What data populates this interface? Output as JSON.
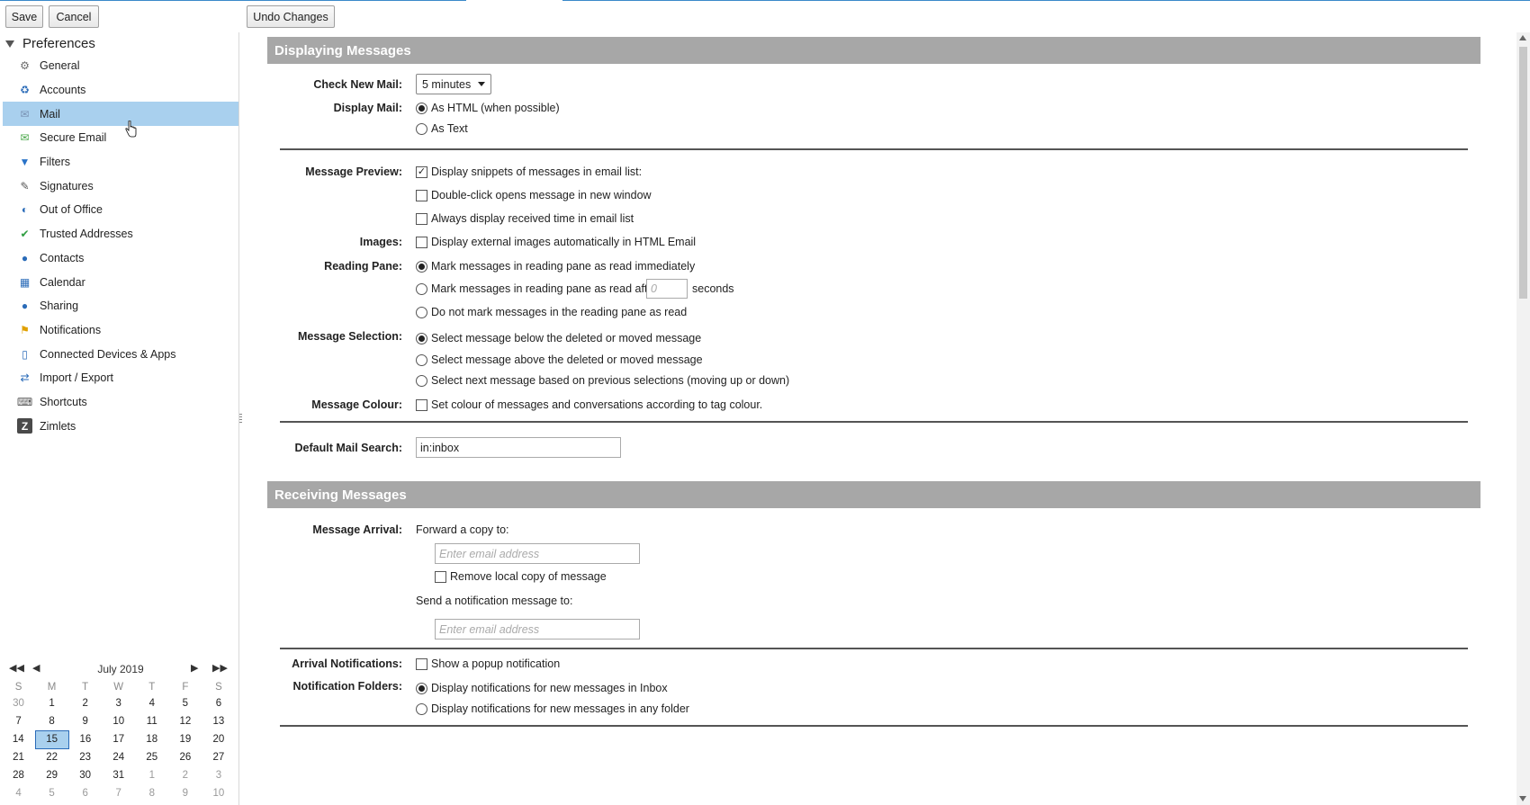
{
  "toolbar": {
    "save": "Save",
    "cancel": "Cancel",
    "undo": "Undo Changes"
  },
  "sidebar": {
    "title": "Preferences",
    "items": [
      {
        "label": "General",
        "icon": "gear-icon"
      },
      {
        "label": "Accounts",
        "icon": "accounts-icon"
      },
      {
        "label": "Mail",
        "icon": "mail-icon",
        "selected": true
      },
      {
        "label": "Secure Email",
        "icon": "secure-email-icon"
      },
      {
        "label": "Filters",
        "icon": "filter-icon"
      },
      {
        "label": "Signatures",
        "icon": "signature-icon"
      },
      {
        "label": "Out of Office",
        "icon": "out-of-office-icon"
      },
      {
        "label": "Trusted Addresses",
        "icon": "shield-icon"
      },
      {
        "label": "Contacts",
        "icon": "contacts-icon"
      },
      {
        "label": "Calendar",
        "icon": "calendar-icon"
      },
      {
        "label": "Sharing",
        "icon": "sharing-icon"
      },
      {
        "label": "Notifications",
        "icon": "bell-icon"
      },
      {
        "label": "Connected Devices & Apps",
        "icon": "device-icon"
      },
      {
        "label": "Import / Export",
        "icon": "import-export-icon"
      },
      {
        "label": "Shortcuts",
        "icon": "keyboard-icon"
      },
      {
        "label": "Zimlets",
        "icon": "zimlet-icon"
      }
    ]
  },
  "calendar": {
    "month": "July 2019",
    "dow": [
      "S",
      "M",
      "T",
      "W",
      "T",
      "F",
      "S"
    ],
    "weeks": [
      [
        "30",
        "1",
        "2",
        "3",
        "4",
        "5",
        "6"
      ],
      [
        "7",
        "8",
        "9",
        "10",
        "11",
        "12",
        "13"
      ],
      [
        "14",
        "15",
        "16",
        "17",
        "18",
        "19",
        "20"
      ],
      [
        "21",
        "22",
        "23",
        "24",
        "25",
        "26",
        "27"
      ],
      [
        "28",
        "29",
        "30",
        "31",
        "1",
        "2",
        "3"
      ],
      [
        "4",
        "5",
        "6",
        "7",
        "8",
        "9",
        "10"
      ]
    ],
    "today": "15"
  },
  "displaying": {
    "title": "Displaying Messages",
    "check_new_mail_label": "Check New Mail:",
    "check_new_mail_value": "5 minutes",
    "display_mail_label": "Display Mail:",
    "display_html": "As HTML (when possible)",
    "display_text": "As Text",
    "message_preview_label": "Message Preview:",
    "preview_snippets": "Display snippets of messages in email list:",
    "preview_dblclick": "Double-click opens message in new window",
    "preview_time": "Always display received time in email list",
    "images_label": "Images:",
    "images_opt": "Display external images automatically in HTML Email",
    "reading_pane_label": "Reading Pane:",
    "rp_immediately": "Mark messages in reading pane as read immediately",
    "rp_after": "Mark messages in reading pane as read after",
    "rp_after_placeholder": "0",
    "rp_seconds": "seconds",
    "rp_never": "Do not mark messages in the reading pane as read",
    "selection_label": "Message Selection:",
    "sel_below": "Select message below the deleted or moved message",
    "sel_above": "Select message above the deleted or moved message",
    "sel_next": "Select next message based on previous selections (moving up or down)",
    "colour_label": "Message Colour:",
    "colour_opt": "Set colour of messages and conversations according to tag colour.",
    "default_search_label": "Default Mail Search:",
    "default_search_value": "in:inbox"
  },
  "receiving": {
    "title": "Receiving Messages",
    "arrival_label": "Message Arrival:",
    "forward_label": "Forward a copy to:",
    "email_placeholder": "Enter email address",
    "remove_local": "Remove local copy of message",
    "notify_label": "Send a notification message to:",
    "arrival_notif_label": "Arrival Notifications:",
    "popup_opt": "Show a popup notification",
    "notif_folders_label": "Notification Folders:",
    "notif_inbox": "Display notifications for new messages in Inbox",
    "notif_any": "Display notifications for new messages in any folder"
  }
}
